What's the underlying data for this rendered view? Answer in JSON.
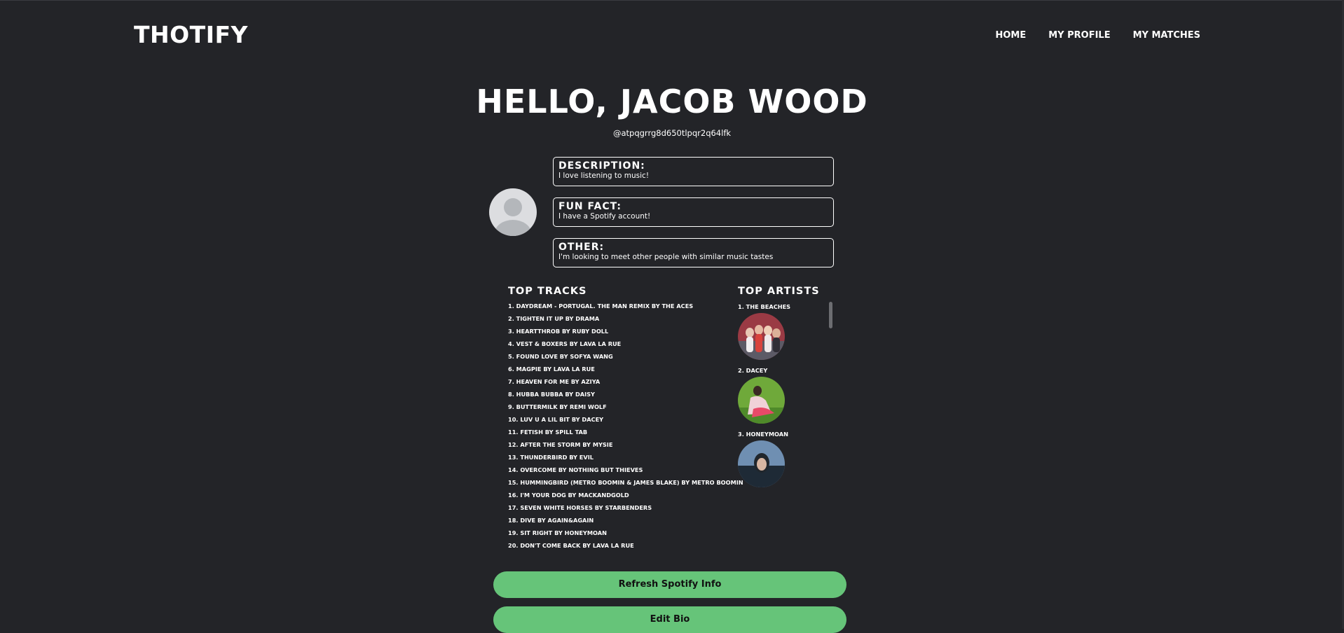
{
  "app": {
    "logo": "THOTIFY"
  },
  "nav": {
    "home": "HOME",
    "my_profile": "MY PROFILE",
    "my_matches": "MY MATCHES"
  },
  "profile": {
    "greeting": "HELLO, JACOB WOOD",
    "handle": "@atpqgrrg8d650tlpqr2q64lfk"
  },
  "bio": {
    "description_label": "DESCRIPTION:",
    "description": "I love listening to music!",
    "fun_fact_label": "FUN FACT:",
    "fun_fact": "I have a Spotify account!",
    "other_label": "OTHER:",
    "other": "I'm looking to meet other people with similar music tastes"
  },
  "top_tracks": {
    "title": "TOP TRACKS",
    "items": [
      "1. DAYDREAM - PORTUGAL. THE MAN REMIX BY THE ACES",
      "2. TIGHTEN IT UP BY DRAMA",
      "3. HEARTTHROB BY RUBY DOLL",
      "4. VEST & BOXERS BY LAVA LA RUE",
      "5. FOUND LOVE BY SOFYA WANG",
      "6. MAGPIE BY LAVA LA RUE",
      "7. HEAVEN FOR ME BY AZIYA",
      "8. HUBBA BUBBA BY DAISY",
      "9. BUTTERMILK BY REMI WOLF",
      "10. LUV U A LIL BIT BY DACEY",
      "11. FETISH BY SPILL TAB",
      "12. AFTER THE STORM BY MYSIE",
      "13. THUNDERBIRD BY EVIL",
      "14. OVERCOME BY NOTHING BUT THIEVES",
      "15. HUMMINGBIRD (METRO BOOMIN & JAMES BLAKE) BY METRO BOOMIN",
      "16. I'M YOUR DOG BY MACKANDGOLD",
      "17. SEVEN WHITE HORSES BY STARBENDERS",
      "18. DIVE BY AGAIN&AGAIN",
      "19. SIT RIGHT BY HONEYMOAN",
      "20. DON'T COME BACK BY LAVA LA RUE"
    ]
  },
  "top_artists": {
    "title": "TOP ARTISTS",
    "items": [
      "1. THE BEACHES",
      "2. DACEY",
      "3. HONEYMOAN"
    ]
  },
  "buttons": {
    "refresh": "Refresh Spotify Info",
    "edit_bio": "Edit Bio"
  },
  "colors": {
    "background": "#232428",
    "accent_button": "#66c479",
    "text": "#ffffff"
  }
}
